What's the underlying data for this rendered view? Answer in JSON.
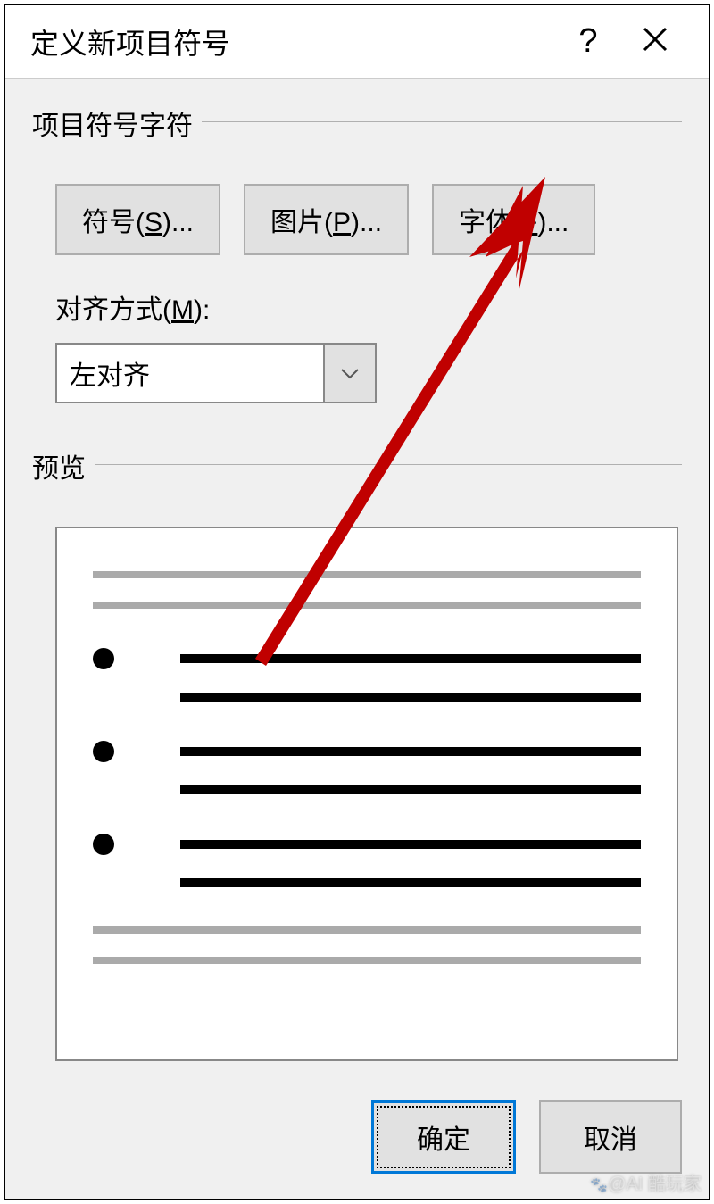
{
  "dialog": {
    "title": "定义新项目符号"
  },
  "section": {
    "bullet_char": "项目符号字符",
    "preview": "预览"
  },
  "buttons": {
    "symbol_pre": "符号(",
    "symbol_key": "S",
    "symbol_post": ")...",
    "picture_pre": "图片(",
    "picture_key": "P",
    "picture_post": ")...",
    "font_pre": "字体(",
    "font_key": "F",
    "font_post": ")..."
  },
  "align": {
    "label_pre": "对齐方式(",
    "label_key": "M",
    "label_post": "):",
    "value": "左对齐"
  },
  "footer": {
    "ok": "确定",
    "cancel": "取消"
  },
  "watermark": "@AI 酷玩家"
}
